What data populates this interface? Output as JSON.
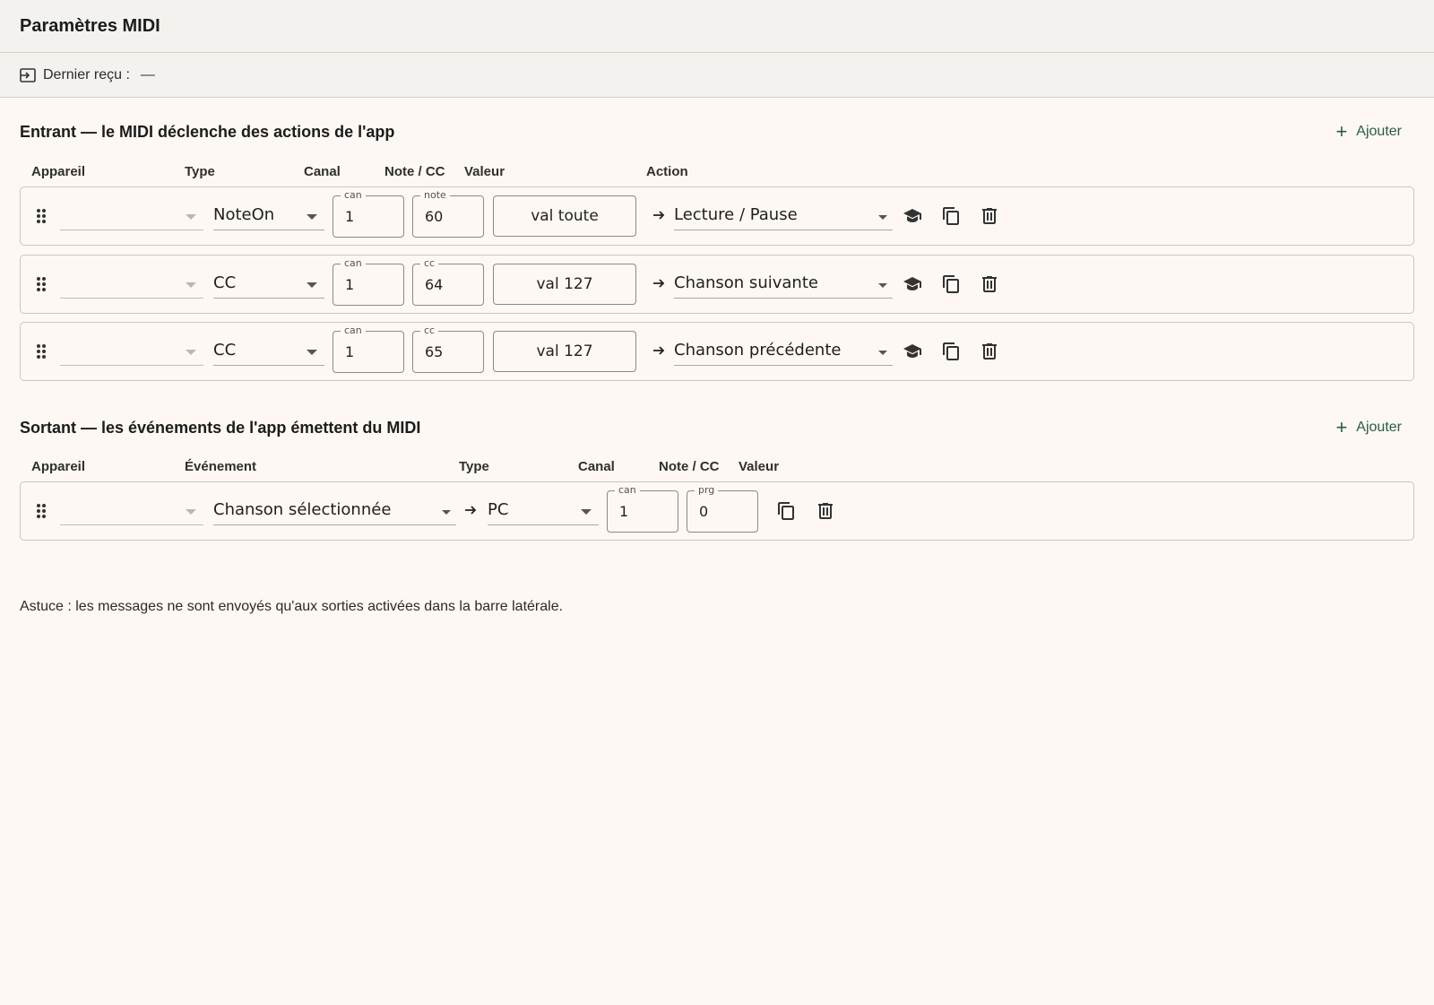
{
  "window": {
    "title": "Paramètres MIDI"
  },
  "status": {
    "label": "Dernier reçu :",
    "value": "—"
  },
  "incoming": {
    "title": "Entrant — le MIDI déclenche des actions de l'app",
    "add_label": "Ajouter",
    "columns": {
      "device": "Appareil",
      "type": "Type",
      "channel": "Canal",
      "note_cc": "Note / CC",
      "value": "Valeur",
      "action": "Action"
    },
    "rows": [
      {
        "device": "",
        "type": "NoteOn",
        "channel_label": "can",
        "channel": "1",
        "num_label": "note",
        "num": "60",
        "value": "val toute",
        "action": "Lecture / Pause"
      },
      {
        "device": "",
        "type": "CC",
        "channel_label": "can",
        "channel": "1",
        "num_label": "cc",
        "num": "64",
        "value": "val 127",
        "action": "Chanson suivante"
      },
      {
        "device": "",
        "type": "CC",
        "channel_label": "can",
        "channel": "1",
        "num_label": "cc",
        "num": "65",
        "value": "val 127",
        "action": "Chanson précédente"
      }
    ]
  },
  "outgoing": {
    "title": "Sortant — les événements de l'app émettent du MIDI",
    "add_label": "Ajouter",
    "columns": {
      "device": "Appareil",
      "event": "Événement",
      "type": "Type",
      "channel": "Canal",
      "note_cc": "Note / CC",
      "value": "Valeur"
    },
    "rows": [
      {
        "device": "",
        "event": "Chanson sélectionnée",
        "type": "PC",
        "channel_label": "can",
        "channel": "1",
        "num_label": "prg",
        "num": "0"
      }
    ]
  },
  "tip": "Astuce : les messages ne sont envoyés qu'aux sorties activées dans la barre latérale.",
  "colors": {
    "accent": "#2a5c47",
    "background": "#fdf8f3",
    "header": "#f3f2ee",
    "border": "#c9c6c0"
  }
}
